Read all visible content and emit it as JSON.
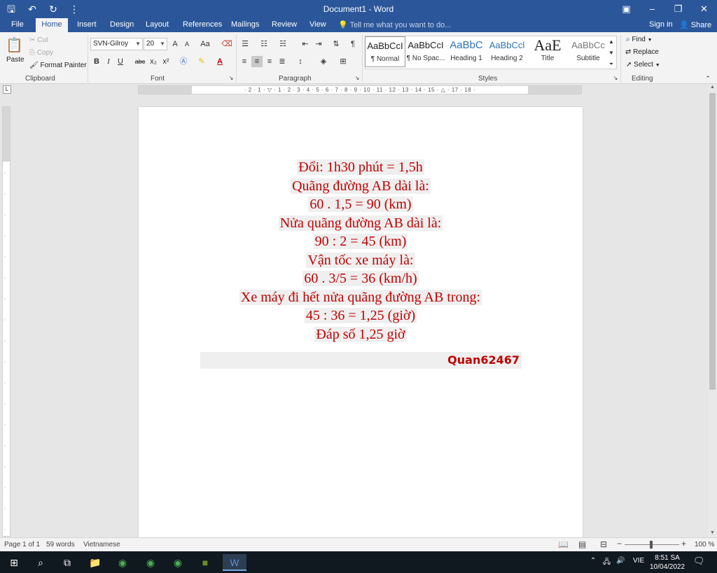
{
  "window": {
    "title": "Document1 - Word"
  },
  "qat": {
    "save_icon": "save-icon",
    "undo_icon": "undo-icon",
    "redo_icon": "redo-icon",
    "customize_icon": "customize-qat-icon"
  },
  "tabs": [
    {
      "label": "File"
    },
    {
      "label": "Home"
    },
    {
      "label": "Insert"
    },
    {
      "label": "Design"
    },
    {
      "label": "Layout"
    },
    {
      "label": "References"
    },
    {
      "label": "Mailings"
    },
    {
      "label": "Review"
    },
    {
      "label": "View"
    }
  ],
  "tell_me": {
    "placeholder": "Tell me what you want to do..."
  },
  "account": {
    "signin": "Sign in",
    "share": "Share"
  },
  "clipboard": {
    "paste": "Paste",
    "cut": "Cut",
    "copy": "Copy",
    "format_painter": "Format Painter",
    "label": "Clipboard"
  },
  "font": {
    "name": "SVN-Gilroy",
    "size": "20",
    "grow": "A",
    "shrink": "A",
    "case": "Aa",
    "bold": "B",
    "italic": "I",
    "underline": "U",
    "strike": "abc",
    "sub": "x₂",
    "sup": "x²",
    "label": "Font"
  },
  "paragraph": {
    "label": "Paragraph",
    "pilcrow": "¶"
  },
  "styles": {
    "label": "Styles",
    "items": [
      {
        "sample": "AaBbCcI",
        "name": "¶ Normal"
      },
      {
        "sample": "AaBbCcI",
        "name": "¶ No Spac..."
      },
      {
        "sample": "AaBbC",
        "name": "Heading 1"
      },
      {
        "sample": "AaBbCcl",
        "name": "Heading 2"
      },
      {
        "sample": "AaE",
        "name": "Title"
      },
      {
        "sample": "AaBbCc",
        "name": "Subtitle"
      }
    ]
  },
  "editing": {
    "find": "Find",
    "replace": "Replace",
    "select": "Select",
    "label": "Editing"
  },
  "ruler": {
    "horizontal": "· 2 · 1 · ▽ · 1 · 2 · 3 · 4 · 5 · 6 · 7 · 8 · 9 · 10 · 11 · 12 · 13 · 14 · 15 · △ · 17 · 18 ·",
    "corner": "L"
  },
  "document": {
    "lines": [
      "Đổi: 1h30 phút = 1,5h",
      "Quãng đường AB dài là:",
      "60 . 1,5 = 90 (km)",
      "Nửa quãng đường AB dài là:",
      "90 : 2 = 45 (km)",
      "Vận tốc xe máy là:",
      "60 . 3/5 = 36 (km/h)",
      "Xe máy đi hết nửa quãng đường AB trong:",
      "45 : 36 = 1,25 (giờ)",
      "Đáp số 1,25 giờ"
    ],
    "signature": "Quan62467",
    "text_color": "#c00000"
  },
  "status": {
    "page": "Page 1 of 1",
    "words": "59 words",
    "language": "Vietnamese",
    "zoom": "100 %"
  },
  "taskbar": {
    "time": "8:51 SA",
    "date": "10/04/2022",
    "lang": "VIE"
  },
  "colors": {
    "accent": "#2b579a"
  }
}
